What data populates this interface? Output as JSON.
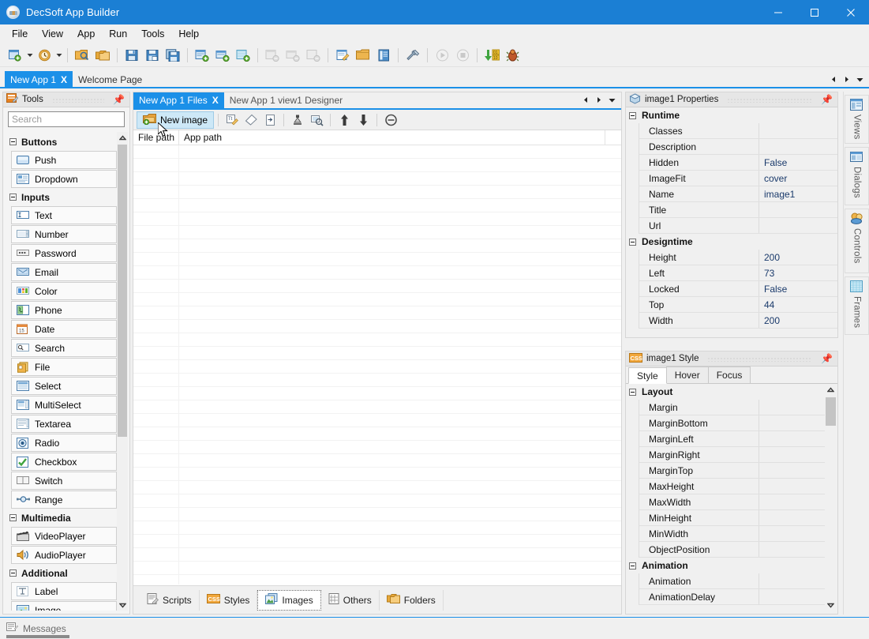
{
  "window": {
    "title": "DecSoft App Builder",
    "app_icon": "app-logo-icon",
    "minimize": "minimize-icon",
    "maximize": "maximize-icon",
    "close": "close-icon"
  },
  "menubar": {
    "items": [
      {
        "label": "File"
      },
      {
        "label": "View"
      },
      {
        "label": "App"
      },
      {
        "label": "Run"
      },
      {
        "label": "Tools"
      },
      {
        "label": "Help"
      }
    ]
  },
  "toolbar": {
    "groups": [
      {
        "items": [
          {
            "name": "new-app-icon",
            "caret": true
          },
          {
            "name": "recent-apps-icon",
            "caret": true
          }
        ]
      },
      {
        "items": [
          {
            "name": "open-app-icon"
          },
          {
            "name": "open-folder-icon"
          }
        ]
      },
      {
        "items": [
          {
            "name": "save-icon"
          },
          {
            "name": "save-as-icon"
          },
          {
            "name": "save-all-icon"
          }
        ]
      },
      {
        "items": [
          {
            "name": "add-view-icon"
          },
          {
            "name": "add-dialog-icon"
          },
          {
            "name": "add-frame-icon"
          }
        ]
      },
      {
        "items": [
          {
            "name": "remove-view-icon"
          },
          {
            "name": "remove-dialog-icon"
          },
          {
            "name": "remove-frame-icon"
          }
        ]
      },
      {
        "items": [
          {
            "name": "edit-script-icon"
          },
          {
            "name": "app-folder-icon"
          },
          {
            "name": "app-docs-icon"
          }
        ]
      },
      {
        "items": [
          {
            "name": "app-options-icon"
          }
        ]
      },
      {
        "items": [
          {
            "name": "run-app-icon"
          },
          {
            "name": "stop-app-icon"
          }
        ]
      },
      {
        "items": [
          {
            "name": "compile-app-icon"
          },
          {
            "name": "debug-app-icon"
          }
        ]
      }
    ]
  },
  "doctabs": {
    "tabs": [
      {
        "label": "New App 1",
        "active": true,
        "close": "x"
      },
      {
        "label": "Welcome Page",
        "active": false
      }
    ],
    "nav": {
      "prev": "prev-tab-icon",
      "next": "next-tab-icon",
      "menu": "tab-menu-icon"
    }
  },
  "tools_panel": {
    "header": {
      "title": "Tools",
      "icon": "tools-icon",
      "pin": "pin-icon"
    },
    "search": {
      "placeholder": "Search",
      "value": ""
    },
    "groups": [
      {
        "label": "Buttons",
        "items": [
          {
            "label": "Push",
            "icon": "push-button-icon"
          },
          {
            "label": "Dropdown",
            "icon": "dropdown-button-icon"
          }
        ]
      },
      {
        "label": "Inputs",
        "items": [
          {
            "label": "Text",
            "icon": "text-input-icon"
          },
          {
            "label": "Number",
            "icon": "number-input-icon"
          },
          {
            "label": "Password",
            "icon": "password-input-icon"
          },
          {
            "label": "Email",
            "icon": "email-input-icon"
          },
          {
            "label": "Color",
            "icon": "color-input-icon"
          },
          {
            "label": "Phone",
            "icon": "phone-input-icon"
          },
          {
            "label": "Date",
            "icon": "date-input-icon"
          },
          {
            "label": "Search",
            "icon": "search-input-icon"
          },
          {
            "label": "File",
            "icon": "file-input-icon"
          },
          {
            "label": "Select",
            "icon": "select-input-icon"
          },
          {
            "label": "MultiSelect",
            "icon": "multiselect-input-icon"
          },
          {
            "label": "Textarea",
            "icon": "textarea-input-icon"
          },
          {
            "label": "Radio",
            "icon": "radio-input-icon"
          },
          {
            "label": "Checkbox",
            "icon": "checkbox-input-icon"
          },
          {
            "label": "Switch",
            "icon": "switch-input-icon"
          },
          {
            "label": "Range",
            "icon": "range-input-icon"
          }
        ]
      },
      {
        "label": "Multimedia",
        "items": [
          {
            "label": "VideoPlayer",
            "icon": "video-player-icon"
          },
          {
            "label": "AudioPlayer",
            "icon": "audio-player-icon"
          }
        ]
      },
      {
        "label": "Additional",
        "items": [
          {
            "label": "Label",
            "icon": "label-icon"
          },
          {
            "label": "Image",
            "icon": "image-icon"
          }
        ]
      }
    ]
  },
  "center_panel": {
    "tabs": [
      {
        "label": "New App 1 Files",
        "active": true,
        "close": "x"
      },
      {
        "label": "New App 1 view1 Designer",
        "active": false
      }
    ],
    "nav": {
      "prev": "prev-tab-icon",
      "next": "next-tab-icon",
      "menu": "tab-menu-icon"
    },
    "toolbar": {
      "new_image_label": "New image",
      "new_image_icon": "new-image-icon",
      "icons": [
        {
          "name": "rename-file-icon"
        },
        {
          "name": "clear-file-icon"
        },
        {
          "name": "copy-path-icon"
        },
        {
          "name": "optimize-image-icon"
        },
        {
          "name": "preview-image-icon"
        },
        {
          "name": "move-up-icon"
        },
        {
          "name": "move-down-icon"
        },
        {
          "name": "delete-file-icon"
        }
      ]
    },
    "list": {
      "columns": [
        "File path",
        "App path"
      ],
      "rows": []
    },
    "bottom_tabs": [
      {
        "label": "Scripts",
        "icon": "scripts-icon",
        "active": false
      },
      {
        "label": "Styles",
        "icon": "styles-icon",
        "active": false
      },
      {
        "label": "Images",
        "icon": "images-icon",
        "active": true
      },
      {
        "label": "Others",
        "icon": "others-icon",
        "active": false
      },
      {
        "label": "Folders",
        "icon": "folders-icon",
        "active": false
      }
    ]
  },
  "properties_panel": {
    "header": {
      "title": "image1 Properties",
      "icon": "properties-icon",
      "pin": "pin-icon"
    },
    "categories": [
      {
        "label": "Runtime",
        "rows": [
          {
            "name": "Classes",
            "value": ""
          },
          {
            "name": "Description",
            "value": ""
          },
          {
            "name": "Hidden",
            "value": "False"
          },
          {
            "name": "ImageFit",
            "value": "cover"
          },
          {
            "name": "Name",
            "value": "image1"
          },
          {
            "name": "Title",
            "value": ""
          },
          {
            "name": "Url",
            "value": ""
          }
        ]
      },
      {
        "label": "Designtime",
        "rows": [
          {
            "name": "Height",
            "value": "200"
          },
          {
            "name": "Left",
            "value": "73"
          },
          {
            "name": "Locked",
            "value": "False"
          },
          {
            "name": "Top",
            "value": "44"
          },
          {
            "name": "Width",
            "value": "200"
          }
        ]
      }
    ]
  },
  "style_panel": {
    "header": {
      "title": "image1 Style",
      "icon": "css-icon",
      "pin": "pin-icon"
    },
    "tabs": [
      {
        "label": "Style",
        "active": true
      },
      {
        "label": "Hover",
        "active": false
      },
      {
        "label": "Focus",
        "active": false
      }
    ],
    "categories": [
      {
        "label": "Layout",
        "rows": [
          {
            "name": "Margin",
            "value": ""
          },
          {
            "name": "MarginBottom",
            "value": ""
          },
          {
            "name": "MarginLeft",
            "value": ""
          },
          {
            "name": "MarginRight",
            "value": ""
          },
          {
            "name": "MarginTop",
            "value": ""
          },
          {
            "name": "MaxHeight",
            "value": ""
          },
          {
            "name": "MaxWidth",
            "value": ""
          },
          {
            "name": "MinHeight",
            "value": ""
          },
          {
            "name": "MinWidth",
            "value": ""
          },
          {
            "name": "ObjectPosition",
            "value": ""
          }
        ]
      },
      {
        "label": "Animation",
        "rows": [
          {
            "name": "Animation",
            "value": ""
          },
          {
            "name": "AnimationDelay",
            "value": ""
          }
        ]
      }
    ]
  },
  "vertical_dock": {
    "buttons": [
      {
        "label": "Views",
        "icon": "views-icon"
      },
      {
        "label": "Dialogs",
        "icon": "dialogs-icon"
      },
      {
        "label": "Controls",
        "icon": "controls-icon"
      },
      {
        "label": "Frames",
        "icon": "frames-icon"
      }
    ]
  },
  "statusbar": {
    "label": "Messages",
    "icon": "messages-icon"
  },
  "colors": {
    "titlebar": "#1b7fd4",
    "accent": "#1b90e8",
    "panel": "#f0f0f0",
    "value_text": "#1a3a6b"
  }
}
